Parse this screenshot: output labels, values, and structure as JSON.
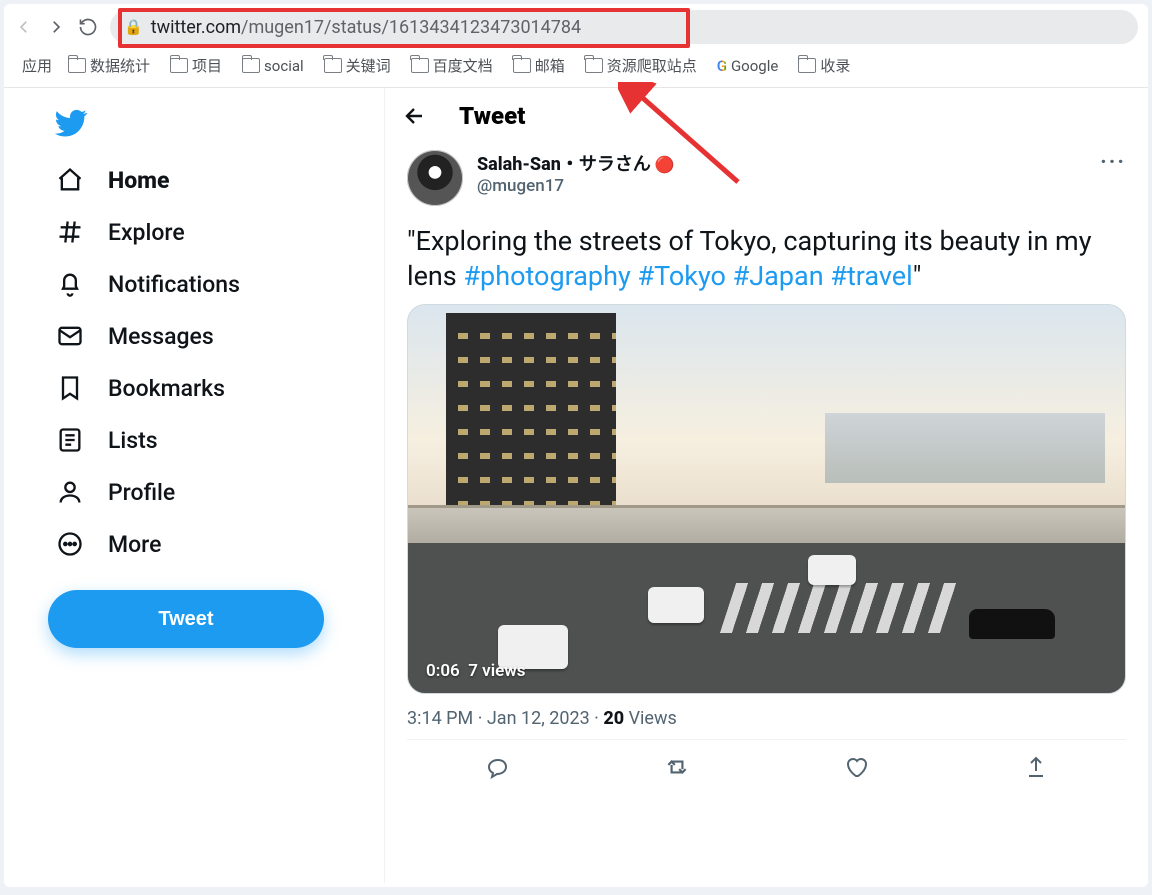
{
  "url": {
    "secure_host": "twitter.com",
    "path": "/mugen17/status/1613434123473014784"
  },
  "bookmarks": {
    "apps_label": "应用",
    "items": [
      "数据统计",
      "项目",
      "social",
      "关键词",
      "百度文档",
      "邮箱",
      "资源爬取站点"
    ],
    "google": "Google",
    "last": "收录"
  },
  "sidebar": {
    "items": [
      "Home",
      "Explore",
      "Notifications",
      "Messages",
      "Bookmarks",
      "Lists",
      "Profile",
      "More"
    ],
    "tweet": "Tweet"
  },
  "header": {
    "title": "Tweet"
  },
  "author": {
    "name": "Salah-San・サラさん",
    "flag": "🔴",
    "handle": "@mugen17"
  },
  "tweet": {
    "text_before": "\"Exploring the streets of Tokyo, capturing its beauty in my lens ",
    "tag1": "#photography",
    "tag2": "#Tokyo",
    "tag3": "#Japan",
    "tag4": "#travel",
    "text_after": "\"",
    "media": {
      "time": "0:06",
      "views": "7 views"
    },
    "meta_time": "3:14 PM · Jan 12, 2023",
    "meta_views_n": "20",
    "meta_views_l": " Views"
  }
}
